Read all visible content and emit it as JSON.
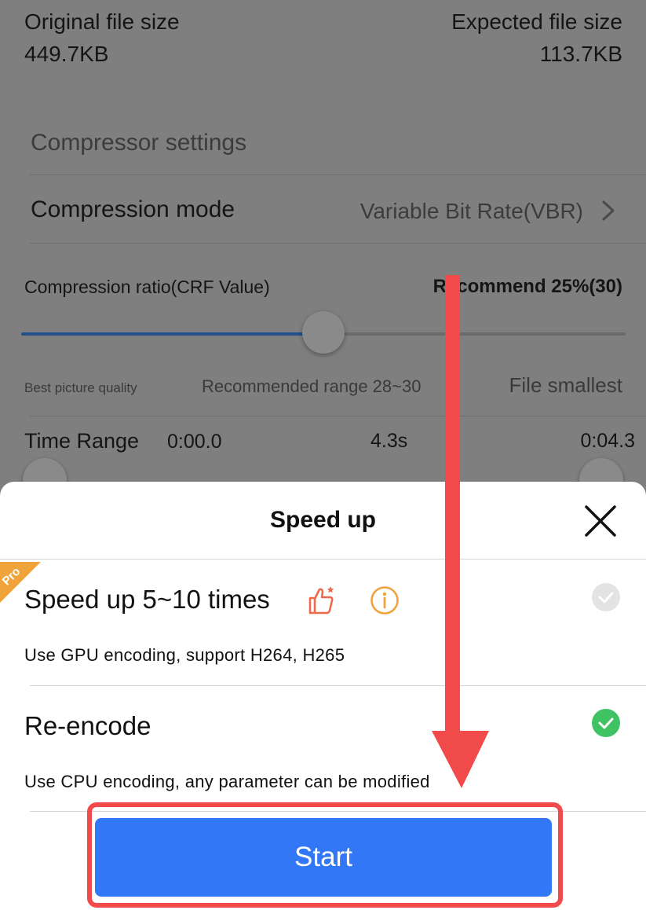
{
  "file_info": {
    "original_label": "Original file size",
    "original_value": "449.7KB",
    "expected_label": "Expected file size",
    "expected_value": "113.7KB"
  },
  "settings": {
    "section_title": "Compressor settings",
    "mode_label": "Compression mode",
    "mode_value": "Variable Bit Rate(VBR)",
    "ratio_label": "Compression ratio(CRF Value)",
    "ratio_recommend": "Recommend 25%(30)",
    "slider_fraction": 0.5,
    "hint_left": "Best picture quality",
    "hint_middle": "Recommended range 28~30",
    "hint_right": "File smallest",
    "time_range_label": "Time Range",
    "time_start": "0:00.0",
    "time_duration": "4.3s",
    "time_end": "0:04.3"
  },
  "sheet": {
    "title": "Speed up",
    "close_icon": "close-icon",
    "pro_badge": "Pro",
    "option1": {
      "title": "Speed up 5~10 times",
      "description": "Use GPU encoding, support H264, H265",
      "selected": false
    },
    "option2": {
      "title": "Re-encode",
      "description": "Use CPU encoding, any parameter can be modified",
      "selected": true
    },
    "start_label": "Start"
  },
  "colors": {
    "accent_blue": "#3177f6",
    "check_green": "#3fc262",
    "annotation_red": "#f04a4a",
    "pro_orange": "#f0a33b"
  }
}
